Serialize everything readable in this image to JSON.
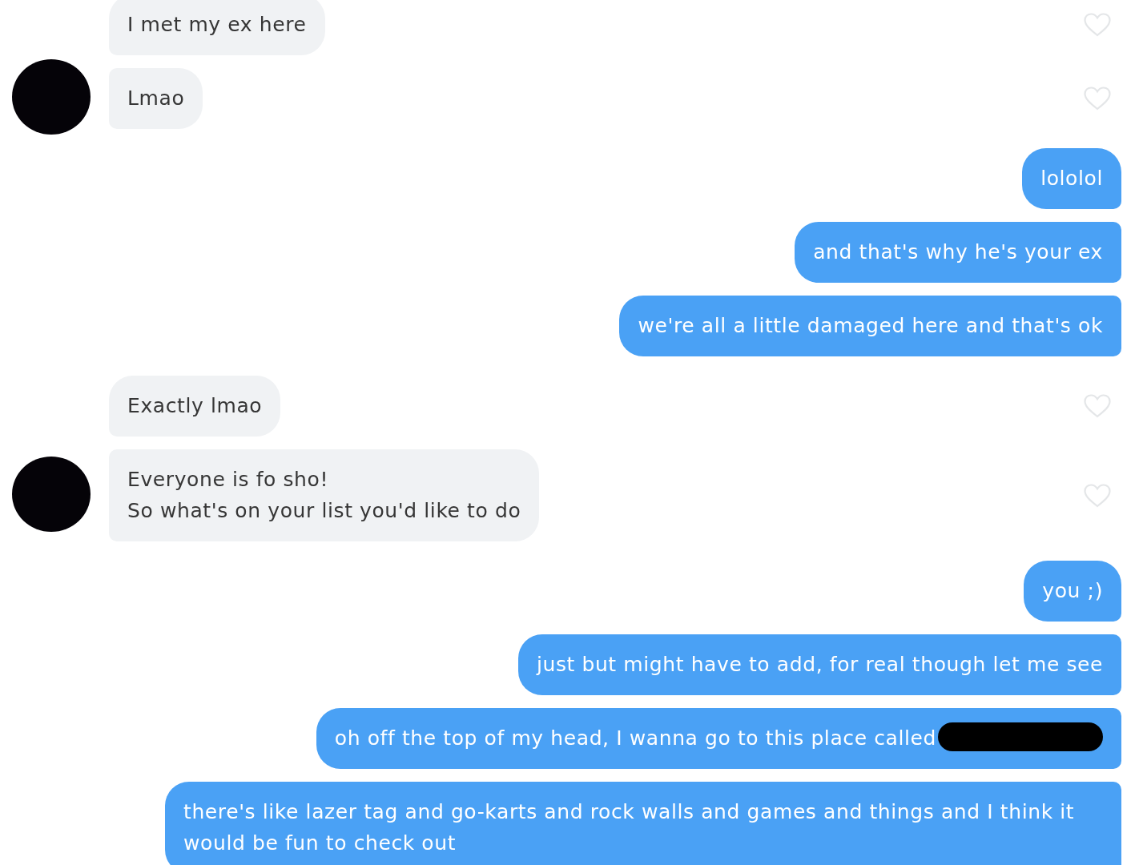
{
  "conversation": [
    {
      "kind": "received",
      "messages": [
        {
          "text": "I met my ex here",
          "liked": false,
          "redacted": false
        },
        {
          "text": "Lmao",
          "liked": false,
          "redacted": false
        }
      ]
    },
    {
      "kind": "sent",
      "messages": [
        {
          "text": "lololol",
          "redacted": false
        },
        {
          "text": "and that's why he's your ex",
          "redacted": false
        },
        {
          "text": "we're all a little damaged here and that's ok",
          "redacted": false
        }
      ]
    },
    {
      "kind": "received",
      "messages": [
        {
          "text": "Exactly lmao",
          "liked": false,
          "redacted": false
        },
        {
          "text": "Everyone is fo sho!\nSo what's on your list you'd like to do",
          "liked": false,
          "redacted": false
        }
      ]
    },
    {
      "kind": "sent",
      "messages": [
        {
          "text": "you ;)",
          "redacted": false
        },
        {
          "text": "just but might have to add, for real though let me see",
          "redacted": false
        },
        {
          "text": "oh off the top of my head, I wanna go to this place called",
          "redacted": true
        },
        {
          "text": "there's like lazer tag and go-karts and rock walls and games and things and I think it would be fun to check out",
          "redacted": false
        }
      ]
    }
  ]
}
